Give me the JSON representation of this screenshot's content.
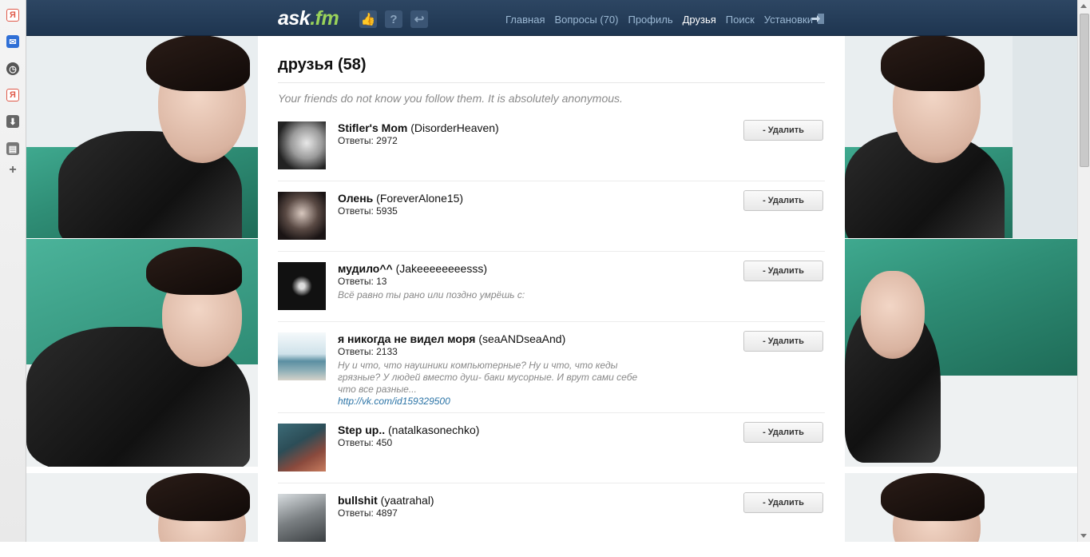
{
  "logo": {
    "main": "ask",
    "suffix": ".fm"
  },
  "nav": {
    "items": [
      "Главная",
      "Вопросы (70)",
      "Профиль",
      "Друзья",
      "Поиск",
      "Установки"
    ],
    "active_index": 3
  },
  "page": {
    "title": "друзья (58)",
    "notice": "Your friends do not know you follow them. It is absolutely anonymous."
  },
  "friends": [
    {
      "name": "Stifler's Mom",
      "username": "(DisorderHeaven)",
      "answers": "Ответы: 2972",
      "bio": "",
      "link": "",
      "delete_label": "- Удалить"
    },
    {
      "name": "Олень",
      "username": "(ForeverAlone15)",
      "answers": "Ответы: 5935",
      "bio": "",
      "link": "",
      "delete_label": "- Удалить"
    },
    {
      "name": "мудило^^",
      "username": "(Jakeeeeeeeesss)",
      "answers": "Ответы: 13",
      "bio": "Всё равно ты рано или поздно умрёшь с:",
      "link": "",
      "delete_label": "- Удалить"
    },
    {
      "name": "я никогда не видел моря",
      "username": "(seaANDseaAnd)",
      "answers": "Ответы: 2133",
      "bio": "Ну и что, что наушники компьютерные? Ну и что, что кеды грязные? У людей вместо душ- баки мусорные. И врут сами себе что все разные...",
      "link": "http://vk.com/id159329500",
      "delete_label": "- Удалить"
    },
    {
      "name": "Step up..",
      "username": "(natalkasonechko)",
      "answers": "Ответы: 450",
      "bio": "",
      "link": "",
      "delete_label": "- Удалить"
    },
    {
      "name": "bullshit",
      "username": "(yaatrahal)",
      "answers": "Ответы: 4897",
      "bio": "",
      "link": "",
      "delete_label": "- Удалить"
    }
  ],
  "icons": {
    "sidebar": [
      "yandex-icon",
      "mail-icon",
      "clock-icon",
      "yandex-icon",
      "pocket-icon",
      "note-icon",
      "plus-icon"
    ],
    "header": [
      "like-icon",
      "question-icon",
      "reply-icon",
      "logout-icon"
    ]
  },
  "colors": {
    "topbar": "#1e3550",
    "logo_accent": "#9ad35a",
    "nav_text": "#9bb8d3",
    "link": "#2a73a6"
  }
}
